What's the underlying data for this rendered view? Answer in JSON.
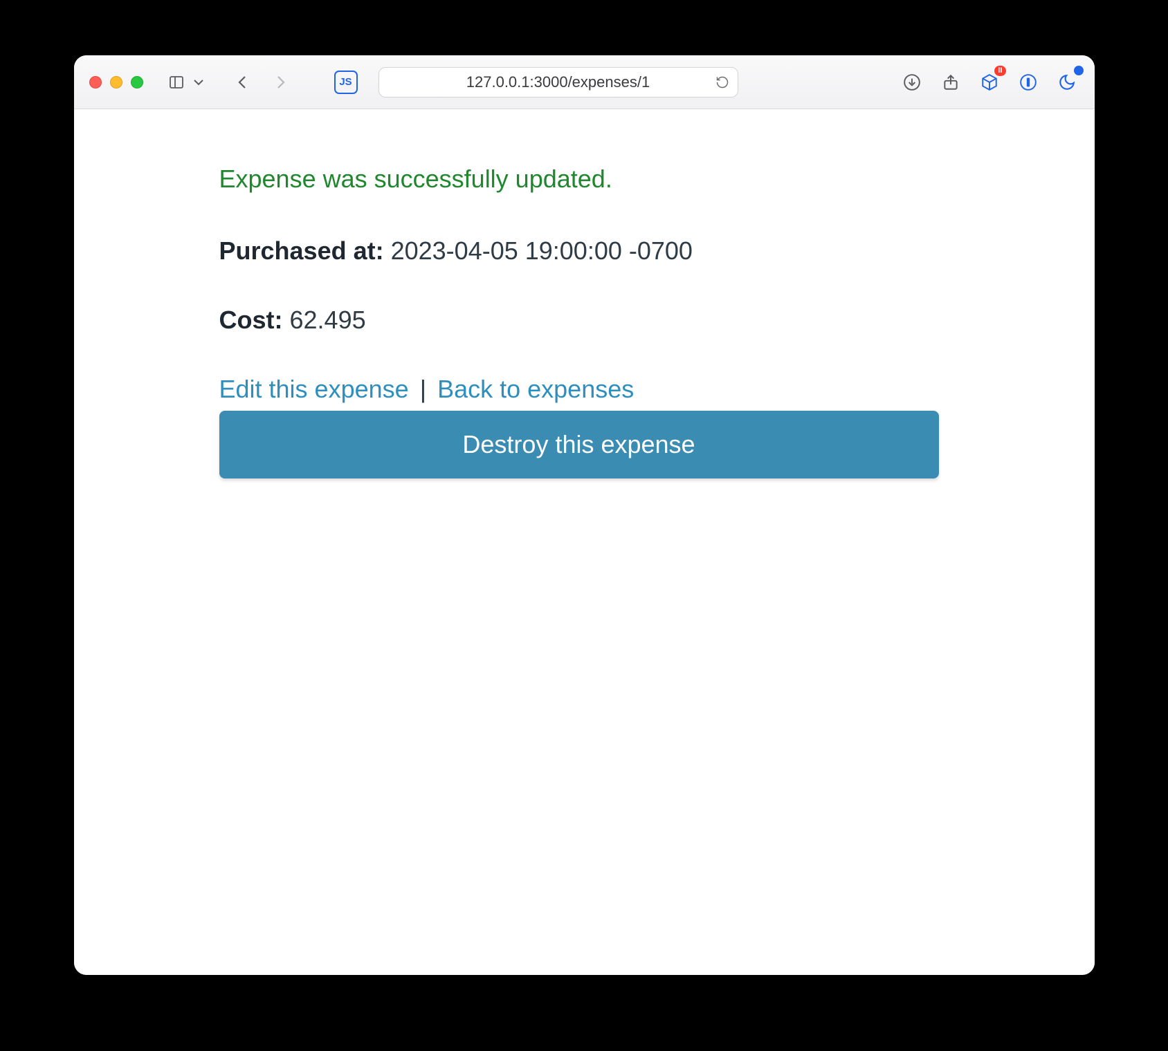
{
  "browser": {
    "url": "127.0.0.1:3000/expenses/1",
    "js_badge": "JS",
    "ext_pause_badge": "II"
  },
  "flash": {
    "notice": "Expense was successfully updated."
  },
  "expense": {
    "purchased_at_label": "Purchased at:",
    "purchased_at_value": "2023-04-05 19:00:00 -0700",
    "cost_label": "Cost:",
    "cost_value": "62.495"
  },
  "actions": {
    "edit_label": "Edit this expense",
    "separator": "|",
    "back_label": "Back to expenses",
    "destroy_label": "Destroy this expense"
  }
}
